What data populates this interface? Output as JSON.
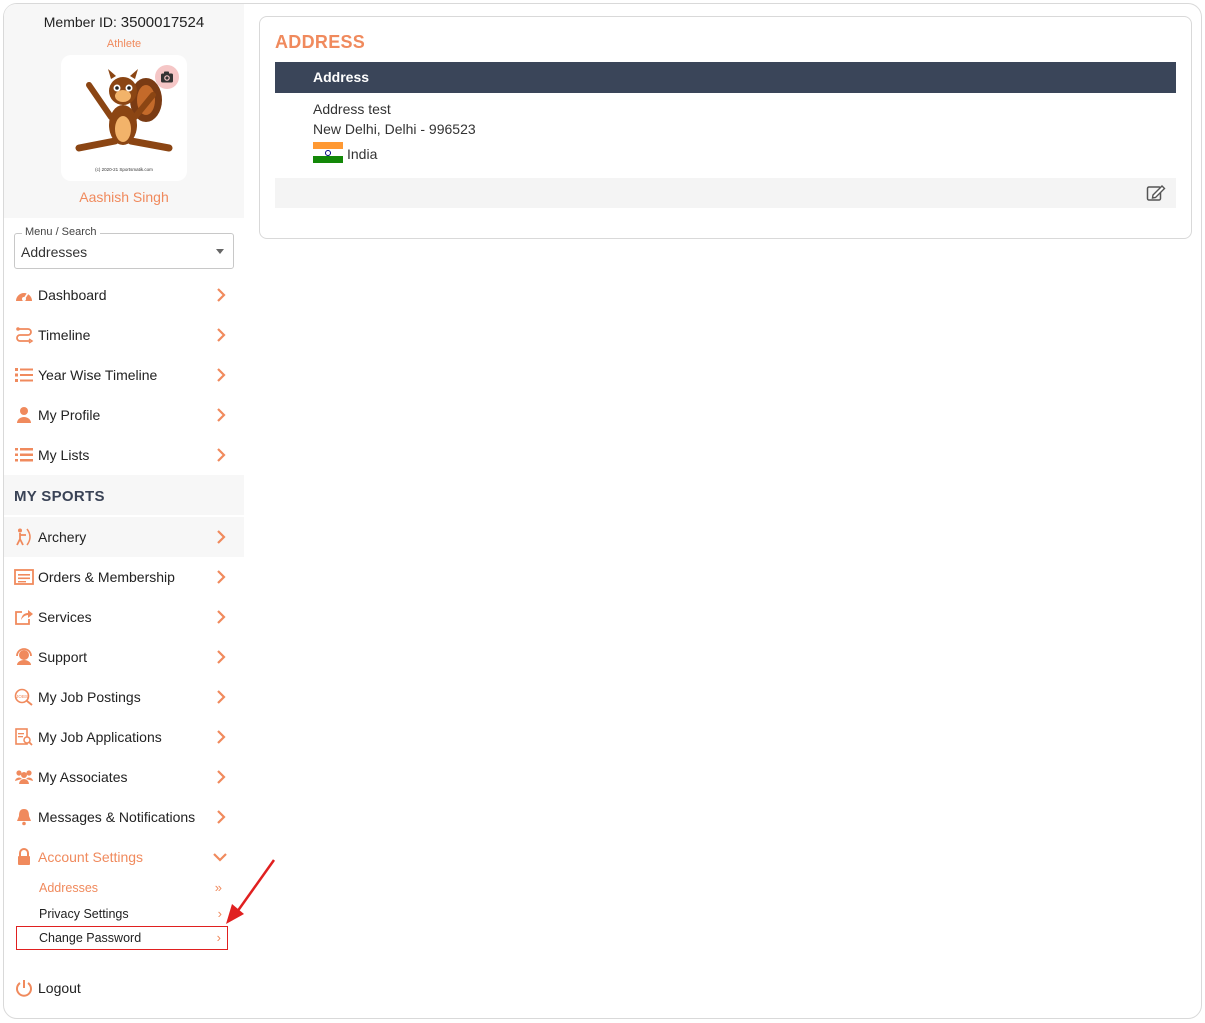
{
  "profile": {
    "member_id_label": "Member ID:",
    "member_id": "3500017524",
    "role": "Athlete",
    "name": "Aashish Singh",
    "avatar_caption": "(c) 2020-21 Sportsmatik.com"
  },
  "menu_search": {
    "legend": "Menu / Search",
    "value": "Addresses"
  },
  "nav": {
    "dashboard": "Dashboard",
    "timeline": "Timeline",
    "year_wise_timeline": "Year Wise Timeline",
    "my_profile": "My Profile",
    "my_lists": "My Lists",
    "my_sports": "MY SPORTS",
    "archery": "Archery",
    "orders": "Orders & Membership",
    "services": "Services",
    "support": "Support",
    "job_postings": "My Job Postings",
    "job_applications": "My Job Applications",
    "associates": "My Associates",
    "messages": "Messages & Notifications",
    "account_settings": "Account Settings",
    "addresses": "Addresses",
    "privacy_settings": "Privacy Settings",
    "change_password": "Change Password",
    "logout": "Logout"
  },
  "address_card": {
    "title": "ADDRESS",
    "table_header": "Address",
    "line1": "Address test",
    "line2": "New Delhi, Delhi - 996523",
    "country": "India"
  },
  "colors": {
    "accent": "#f08a5d",
    "header_dark": "#3a4559",
    "highlight_red": "#e02020"
  }
}
